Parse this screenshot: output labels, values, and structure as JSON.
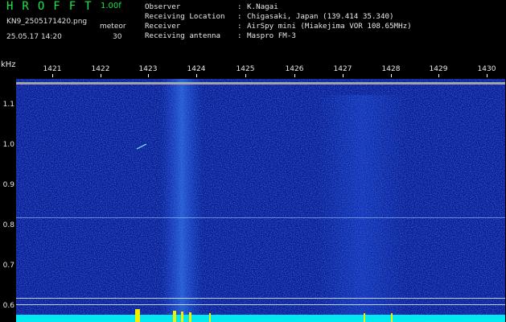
{
  "header": {
    "title": "HROFFT",
    "version": "1.00f",
    "filename": "KN9_2505171420.png",
    "mode": "meteor",
    "datetime": "25.05.17 14:20",
    "count": "30"
  },
  "info": [
    {
      "key": "Observer",
      "value": "K.Nagai"
    },
    {
      "key": "Receiving Location",
      "value": "Chigasaki, Japan (139.414 35.340)"
    },
    {
      "key": "Receiver",
      "value": "AirSpy mini (Miakejima VOR 108.65MHz)"
    },
    {
      "key": "Receiving antenna",
      "value": "Maspro FM-3"
    }
  ],
  "axes": {
    "y_unit": "kHz",
    "y_ticks": [
      "1.1",
      "1.0",
      "0.9",
      "0.8",
      "0.7",
      "0.6"
    ],
    "x_ticks": [
      "1421",
      "1422",
      "1423",
      "1424",
      "1425",
      "1426",
      "1427",
      "1428",
      "1429",
      "1430"
    ]
  },
  "colors": {
    "background": "#000000",
    "title_green": "#18e848",
    "spectrogram_base": "#0a1a8c",
    "baseline_cyan": "#00e8f0",
    "burst_yellow": "#f0f000"
  }
}
